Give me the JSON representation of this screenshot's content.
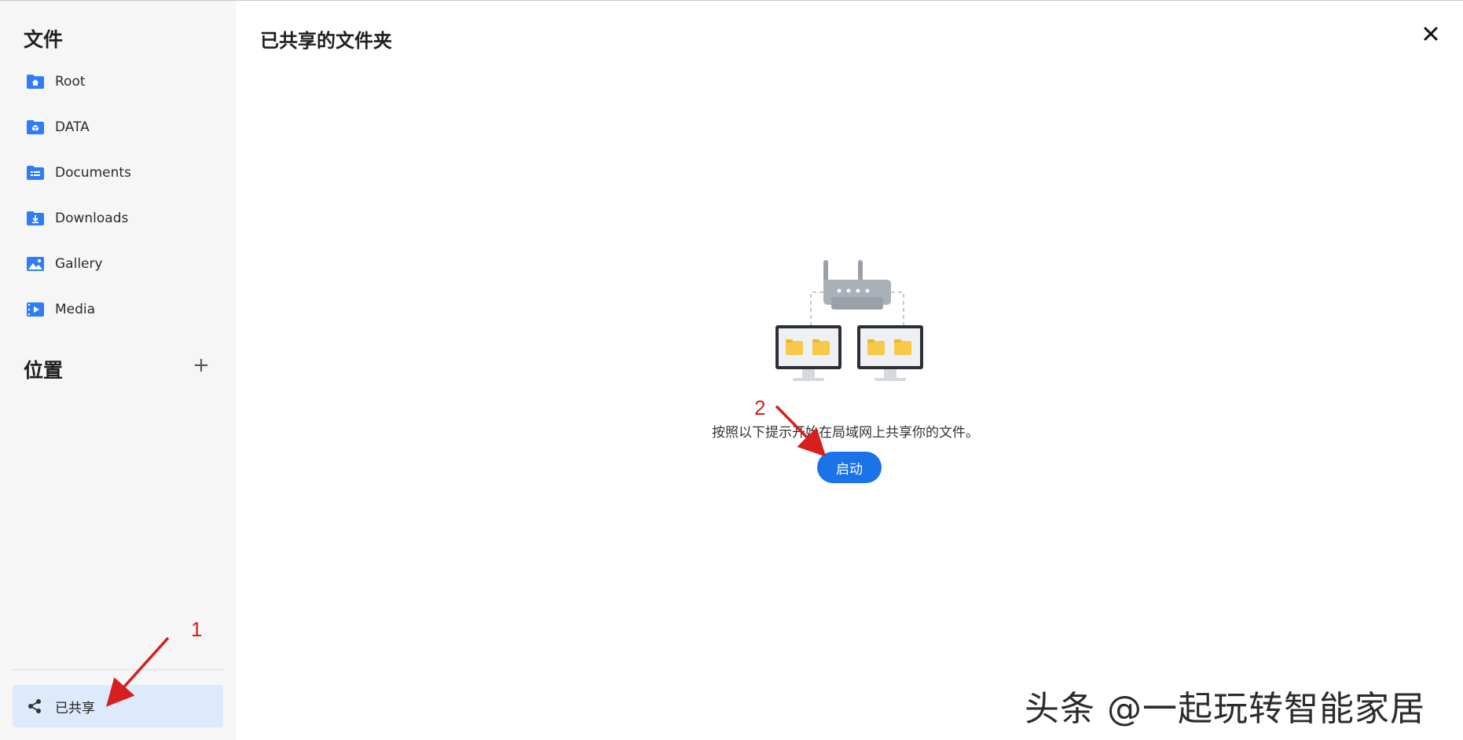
{
  "sidebar": {
    "files_title": "文件",
    "items": [
      {
        "label": "Root",
        "icon": "home-folder-icon"
      },
      {
        "label": "DATA",
        "icon": "data-folder-icon"
      },
      {
        "label": "Documents",
        "icon": "documents-folder-icon"
      },
      {
        "label": "Downloads",
        "icon": "downloads-folder-icon"
      },
      {
        "label": "Gallery",
        "icon": "gallery-icon"
      },
      {
        "label": "Media",
        "icon": "media-icon"
      }
    ],
    "locations_title": "位置",
    "add_label": "+",
    "shared_label": "已共享",
    "shared_icon": "share-icon"
  },
  "main": {
    "title": "已共享的文件夹",
    "prompt": "按照以下提示开始在局域网上共享你的文件。",
    "start_label": "启动"
  },
  "annotations": {
    "marker_1": "1",
    "marker_2": "2",
    "color": "#d61f1f"
  },
  "watermark": "头条 @一起玩转智能家居",
  "colors": {
    "accent": "#1a73e8",
    "folder_blue": "#2f7df6",
    "selected_bg": "#ddeafb",
    "sidebar_bg": "#f6f6f7"
  }
}
